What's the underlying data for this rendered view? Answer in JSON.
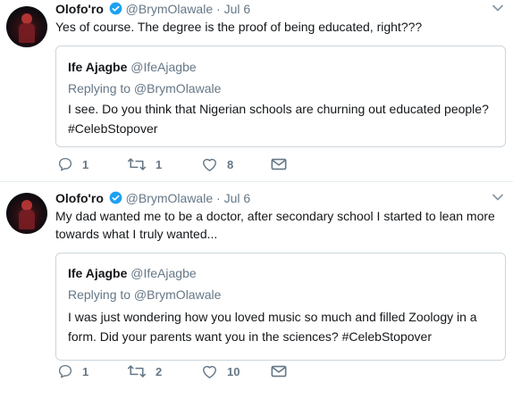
{
  "tweets": [
    {
      "name": "Olofo'ro",
      "handle": "@BrymOlawale",
      "date": "Jul 6",
      "text": "Yes of course. The degree is the proof of being educated, right???",
      "quote": {
        "name": "Ife Ajagbe",
        "handle": "@IfeAjagbe",
        "replying": "Replying to @BrymOlawale",
        "text": "I see. Do you think that Nigerian schools are churning out educated people? #CelebStopover"
      },
      "replies": "1",
      "retweets": "1",
      "likes": "8"
    },
    {
      "name": "Olofo'ro",
      "handle": "@BrymOlawale",
      "date": "Jul 6",
      "text": "My dad wanted me to be a doctor, after secondary school I started to lean more towards what I truly wanted...",
      "quote": {
        "name": "Ife Ajagbe",
        "handle": "@IfeAjagbe",
        "replying": "Replying to @BrymOlawale",
        "text": "I was just wondering how you loved music so much and filled Zoology in a form. Did your parents want you in the sciences? #CelebStopover"
      },
      "replies": "1",
      "retweets": "2",
      "likes": "10"
    }
  ],
  "separator": "·",
  "icons": {
    "verified": "verified-badge-icon",
    "caret": "chevron-down-icon",
    "reply": "reply-icon",
    "retweet": "retweet-icon",
    "like": "heart-icon",
    "dm": "envelope-icon"
  },
  "colors": {
    "verified": "#1da1f2",
    "muted": "#657786",
    "border": "#ccd6dd"
  }
}
